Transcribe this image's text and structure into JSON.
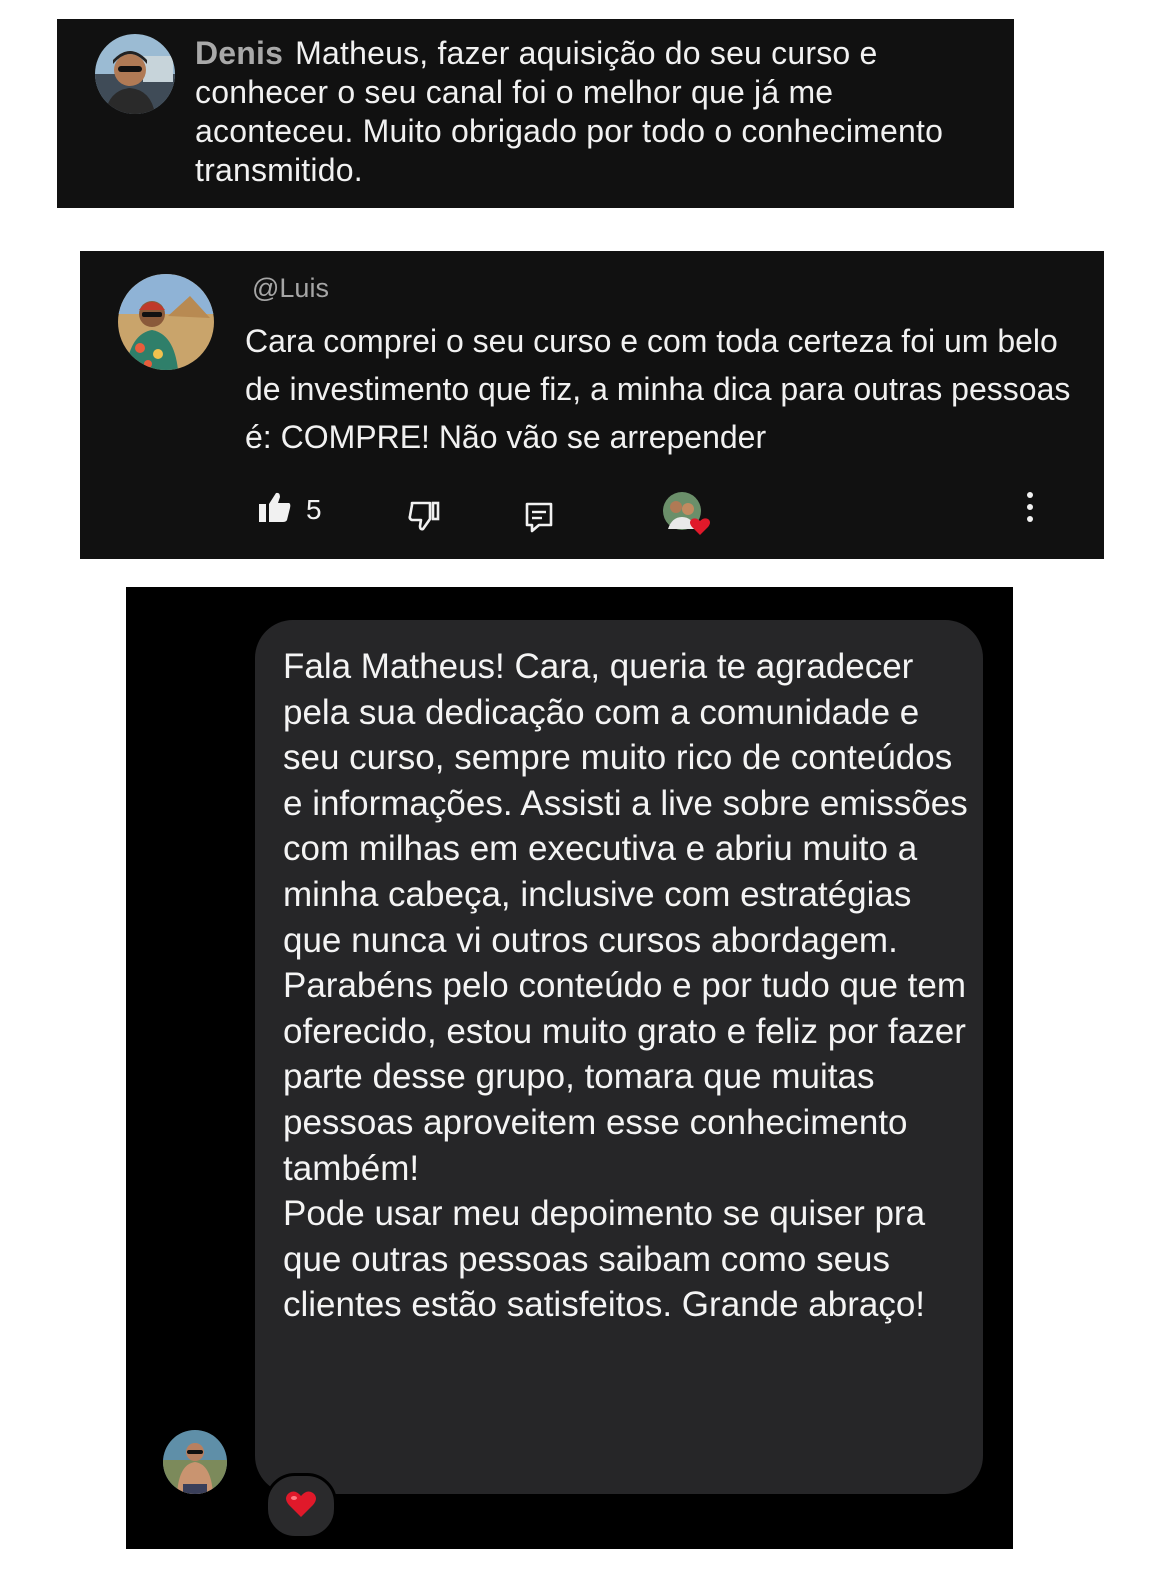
{
  "card_denis": {
    "author": "Denis",
    "text": "Matheus, fazer aquisição do seu curso e conhecer o seu canal foi o melhor que já me aconteceu. Muito obrigado por todo o conhecimento transmitido."
  },
  "card_luis": {
    "handle": "@Luis",
    "comment": "Cara comprei o seu  curso e com toda certeza foi um belo de investimento que fiz, a minha dica para outras pessoas é: COMPRE! Não vão se arrepender",
    "like_count": "5",
    "icons": [
      "thumb-up-icon",
      "thumb-down-icon",
      "reply-icon",
      "creator-heart-icon",
      "more-vert-icon"
    ]
  },
  "card_chat": {
    "message": "Fala Matheus! Cara, queria te agradecer pela sua dedicação com a comunidade e seu curso, sempre muito rico de conteúdos e informações. Assisti a live sobre emissões com milhas em executiva e abriu muito a minha cabeça, inclusive com estratégias que nunca vi outros cursos abordagem. Parabéns pelo conteúdo e por tudo que tem oferecido, estou muito grato e feliz por fazer parte desse grupo, tomara que muitas pessoas aproveitem esse conhecimento também!\nPode usar meu depoimento se quiser pra que outras pessoas saibam como seus clientes estão satisfeitos. Grande abraço!",
    "reaction": "heart"
  },
  "colors": {
    "card_bg": "#111111",
    "chat_bg": "#000000",
    "bubble_bg": "#262628",
    "heart": "#e0192a"
  }
}
